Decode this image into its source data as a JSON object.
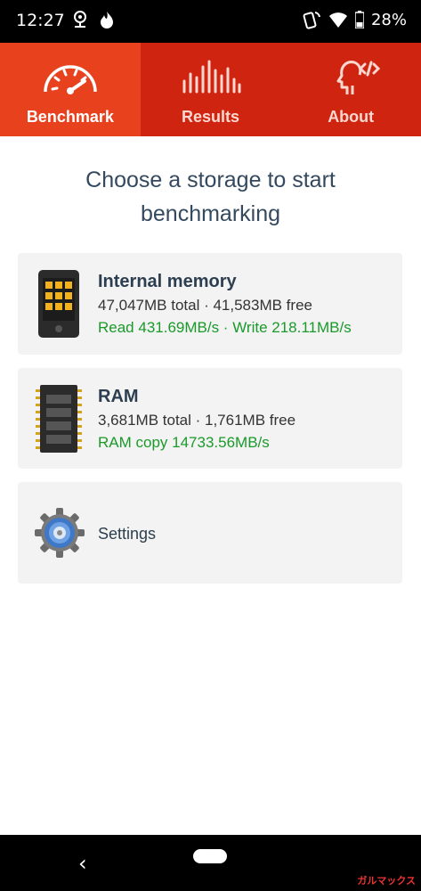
{
  "status": {
    "time": "12:27",
    "battery": "28%"
  },
  "tabs": [
    {
      "label": "Benchmark",
      "icon": "speedometer-icon",
      "active": true
    },
    {
      "label": "Results",
      "icon": "bar-chart-icon",
      "active": false
    },
    {
      "label": "About",
      "icon": "head-code-icon",
      "active": false
    }
  ],
  "heading": "Choose a storage to start benchmarking",
  "cards": {
    "internal": {
      "title": "Internal memory",
      "line": "47,047MB total · 41,583MB free",
      "speed": "Read 431.69MB/s · Write 218.11MB/s"
    },
    "ram": {
      "title": "RAM",
      "line": "3,681MB total · 1,761MB free",
      "speed": "RAM copy 14733.56MB/s"
    },
    "settings": {
      "label": "Settings"
    }
  },
  "nav": {
    "back": "‹"
  },
  "watermark": "ガルマックス",
  "colors": {
    "tab_bg": "#cf2410",
    "tab_active": "#e8411e",
    "green": "#1a9a2a"
  }
}
